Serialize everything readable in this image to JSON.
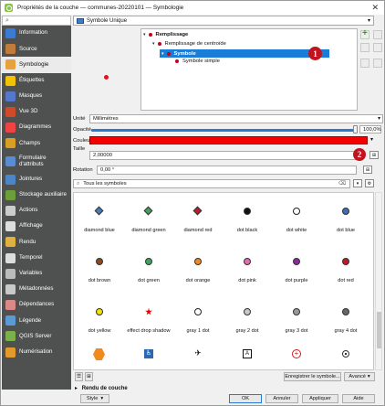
{
  "window": {
    "title": "Propriétés de la couche — communes-20220101 — Symbologie",
    "close_glyph": "✕"
  },
  "sidebar": {
    "items": [
      {
        "label": "Information",
        "icon": "info-icon",
        "color": "#3a7bd5"
      },
      {
        "label": "Source",
        "icon": "source-icon",
        "color": "#c27c3a"
      },
      {
        "label": "Symbologie",
        "icon": "symbology-icon",
        "color": "#e6a23c",
        "active": true
      },
      {
        "label": "Étiquettes",
        "icon": "labels-icon",
        "color": "#f2c300"
      },
      {
        "label": "Masques",
        "icon": "masks-icon",
        "color": "#5577cc"
      },
      {
        "label": "Vue 3D",
        "icon": "view3d-icon",
        "color": "#d04a2a"
      },
      {
        "label": "Diagrammes",
        "icon": "diagrams-icon",
        "color": "#e44"
      },
      {
        "label": "Champs",
        "icon": "fields-icon",
        "color": "#d7a022"
      },
      {
        "label": "Formulaire d'attributs",
        "icon": "form-icon",
        "color": "#5a8bd6"
      },
      {
        "label": "Jointures",
        "icon": "joins-icon",
        "color": "#4a86c8"
      },
      {
        "label": "Stockage auxiliaire",
        "icon": "aux-storage-icon",
        "color": "#6a9f3a"
      },
      {
        "label": "Actions",
        "icon": "actions-icon",
        "color": "#ccc"
      },
      {
        "label": "Affichage",
        "icon": "display-icon",
        "color": "#ddd"
      },
      {
        "label": "Rendu",
        "icon": "rendering-icon",
        "color": "#e0b040"
      },
      {
        "label": "Temporel",
        "icon": "temporal-icon",
        "color": "#ddd"
      },
      {
        "label": "Variables",
        "icon": "variables-icon",
        "color": "#bbb"
      },
      {
        "label": "Métadonnées",
        "icon": "metadata-icon",
        "color": "#c9c9c9"
      },
      {
        "label": "Dépendances",
        "icon": "dependencies-icon",
        "color": "#d88"
      },
      {
        "label": "Légende",
        "icon": "legend-icon",
        "color": "#5a9bd5"
      },
      {
        "label": "QGIS Server",
        "icon": "server-icon",
        "color": "#7bb04a"
      },
      {
        "label": "Numérisation",
        "icon": "digitizing-icon",
        "color": "#e39a2b"
      }
    ]
  },
  "renderer": {
    "type_label": "Symbole Unique"
  },
  "tree": {
    "n1": "Remplissage",
    "n2": "Remplissage de centroïde",
    "n3": "Symbole",
    "n4": "Symbole simple",
    "badge1": "1"
  },
  "props": {
    "unit_label": "Unité",
    "unit_value": "Millimètres",
    "opacity_label": "Opacité",
    "opacity_value": "100,0%",
    "color_label": "Couleur",
    "size_label": "Taille",
    "size_value": "2,00000",
    "rotation_label": "Rotation",
    "rotation_value": "0,00 °",
    "badge2": "2",
    "fill_color": "#f40000"
  },
  "filter": {
    "value": "Tous les symboles"
  },
  "symbols": [
    {
      "name": "diamond blue",
      "shape": "diamond",
      "color": "#3d7fbf"
    },
    {
      "name": "diamond green",
      "shape": "diamond",
      "color": "#3aa55a"
    },
    {
      "name": "diamond red",
      "shape": "diamond",
      "color": "#c0182a"
    },
    {
      "name": "dot  black",
      "shape": "dot",
      "color": "#111111"
    },
    {
      "name": "dot  white",
      "shape": "dot-outline",
      "color": "#ffffff"
    },
    {
      "name": "dot blue",
      "shape": "dot",
      "color": "#3d6faf"
    },
    {
      "name": "dot brown",
      "shape": "dot",
      "color": "#8a4a1e"
    },
    {
      "name": "dot green",
      "shape": "dot",
      "color": "#3aa55a"
    },
    {
      "name": "dot orange",
      "shape": "dot",
      "color": "#f08a1c"
    },
    {
      "name": "dot pink",
      "shape": "dot",
      "color": "#e66ab0"
    },
    {
      "name": "dot purple",
      "shape": "dot",
      "color": "#8a2a9a"
    },
    {
      "name": "dot red",
      "shape": "dot",
      "color": "#c0182a"
    },
    {
      "name": "dot yellow",
      "shape": "dot",
      "color": "#f2e200"
    },
    {
      "name": "effect drop shadow",
      "shape": "star",
      "color": "#e00000"
    },
    {
      "name": "gray 1 dot",
      "shape": "dot-outline",
      "color": "#ffffff"
    },
    {
      "name": "gray 2 dot",
      "shape": "dot",
      "color": "#c8c8c8"
    },
    {
      "name": "gray 3 dot",
      "shape": "dot",
      "color": "#999999"
    },
    {
      "name": "gray 4 dot",
      "shape": "dot",
      "color": "#666666"
    },
    {
      "name": "",
      "shape": "hex",
      "color": "#f08a1c"
    },
    {
      "name": "",
      "shape": "wheelchair",
      "color": "#2a6ab0"
    },
    {
      "name": "",
      "shape": "plane",
      "color": "#111111"
    },
    {
      "name": "",
      "shape": "square-a",
      "color": "#111111"
    },
    {
      "name": "",
      "shape": "cross",
      "color": "#d01a1a"
    },
    {
      "name": "",
      "shape": "target",
      "color": "#333333"
    }
  ],
  "buttons": {
    "save_symbol": "Enregistrer le symbole...",
    "advanced": "Avancé"
  },
  "layer_rendering": "Rendu de couche",
  "footer": {
    "style": "Style",
    "ok": "OK",
    "cancel": "Annuler",
    "apply": "Appliquer",
    "help": "Aide"
  }
}
